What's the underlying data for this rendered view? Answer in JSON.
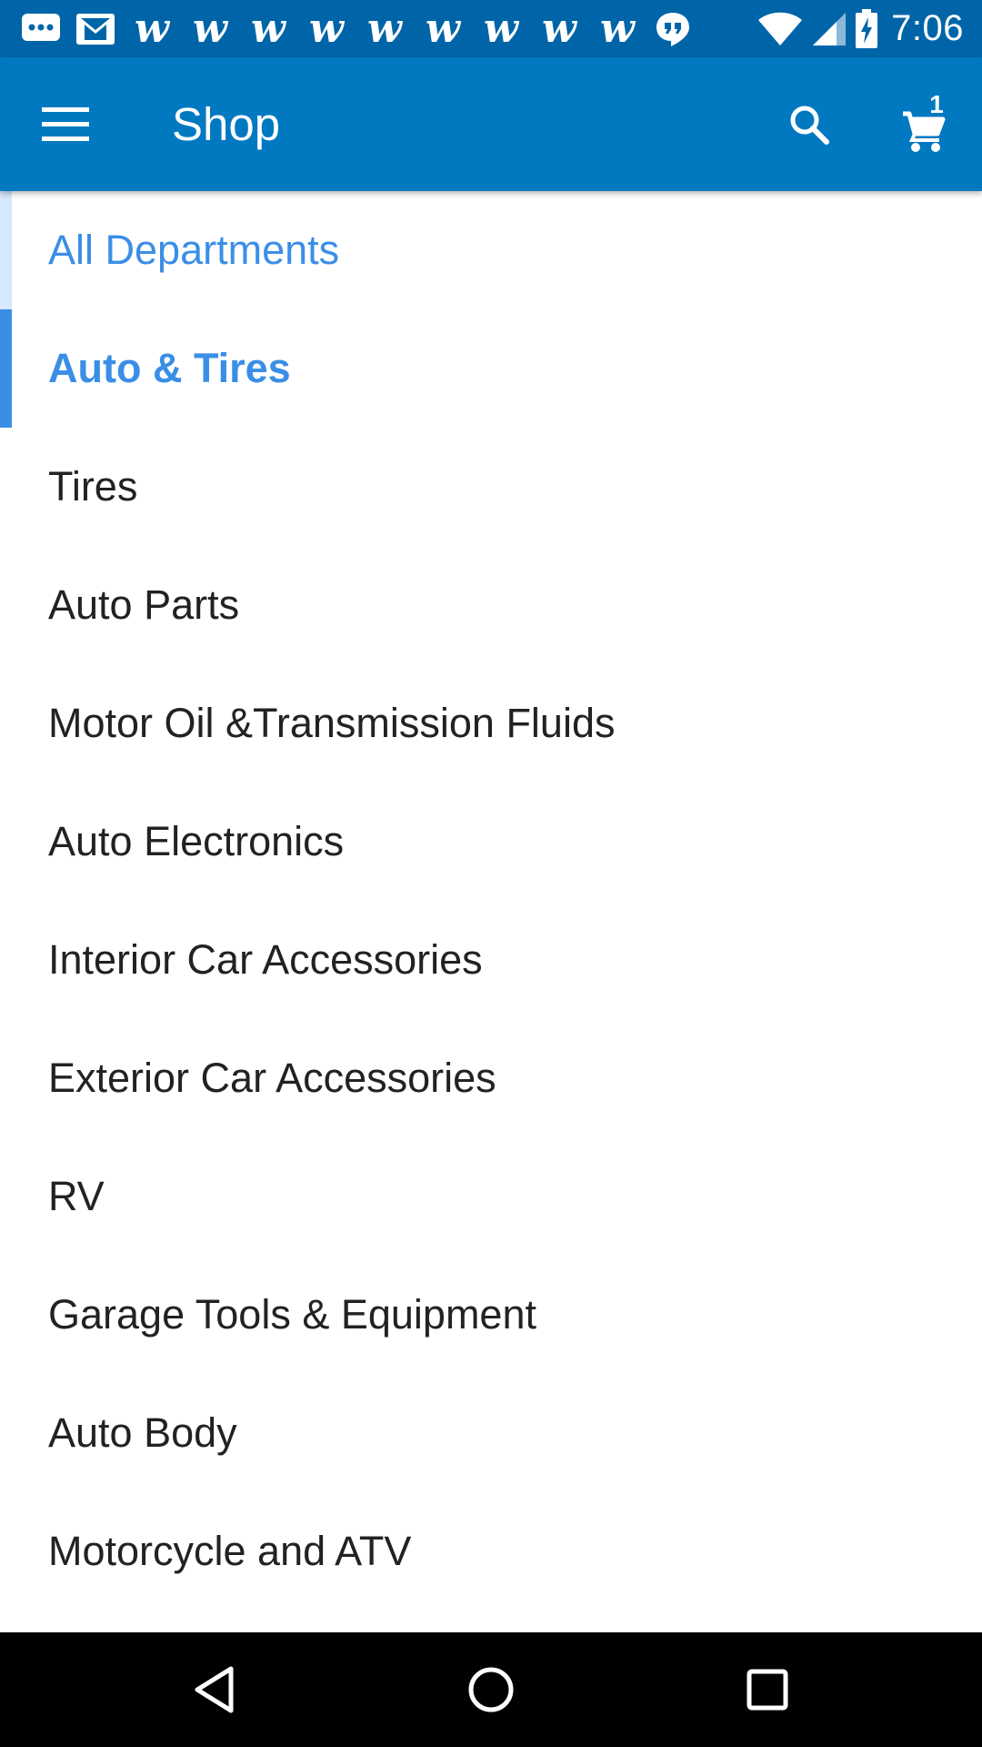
{
  "status_bar": {
    "time": "7:06",
    "left_icons": [
      "chat-icon",
      "gmail-icon",
      "walmart-w-icon",
      "walmart-w-icon",
      "walmart-w-icon",
      "walmart-w-icon",
      "walmart-w-icon",
      "walmart-w-icon",
      "walmart-w-icon",
      "walmart-w-icon",
      "walmart-w-icon",
      "hangouts-icon"
    ],
    "w_glyph": "w",
    "right_icons": [
      "wifi-icon",
      "cell-signal-icon",
      "battery-charging-icon"
    ]
  },
  "app_bar": {
    "title": "Shop",
    "cart_count": "1",
    "background": "#0079c1"
  },
  "departments": {
    "parent_label": "All Departments",
    "active_label": "Auto & Tires",
    "items": [
      "Tires",
      "Auto Parts",
      "Motor Oil &Transmission Fluids",
      "Auto Electronics",
      "Interior Car Accessories",
      "Exterior Car Accessories",
      "RV",
      "Garage Tools & Equipment",
      "Auto Body",
      "Motorcycle and ATV"
    ],
    "accent_color": "#3a8ee6"
  },
  "nav_bar": {
    "buttons": [
      "back-icon",
      "home-icon",
      "recents-icon"
    ]
  }
}
